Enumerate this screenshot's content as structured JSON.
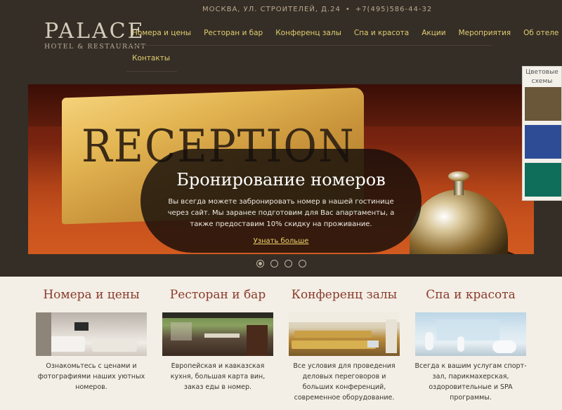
{
  "header": {
    "address": "МОСКВА, УЛ. СТРОИТЕЛЕЙ, Д.24",
    "phone": "+7(495)586-44-32"
  },
  "logo": {
    "main": "PALACE",
    "sub": "HOTEL & RESTAURANT"
  },
  "nav": {
    "items": [
      {
        "label": "Номера и цены"
      },
      {
        "label": "Ресторан и бар"
      },
      {
        "label": "Конференц залы"
      },
      {
        "label": "Спа и красота"
      },
      {
        "label": "Акции"
      },
      {
        "label": "Мероприятия"
      },
      {
        "label": "Об отеле"
      },
      {
        "label": "Контакты"
      }
    ]
  },
  "color_schemes": {
    "title": "Цветовые схемы",
    "swatches": [
      "#6a5638",
      "#2e4c96",
      "#0e6e5a"
    ]
  },
  "hero": {
    "image_text": "RECEPTION",
    "title": "Бронирование номеров",
    "text": "Вы всегда можете забронировать номер в нашей гостинице через сайт. Мы заранее подготовим для Вас апартаменты, а также предоставим 10% скидку на проживание.",
    "link": "Узнать больше",
    "slides_count": 4,
    "active_slide": 1
  },
  "features": [
    {
      "title": "Номера и цены",
      "text": "Ознакомьтесь с ценами и фотографиями наших уютных номеров."
    },
    {
      "title": "Ресторан и бар",
      "text": "Европейская и кавказская кухня, большая карта вин, заказ еды в номер."
    },
    {
      "title": "Конференц залы",
      "text": "Все условия для проведения деловых переговоров и больших конференций, современное оборудование."
    },
    {
      "title": "Спа и красота",
      "text": "Всегда к вашим услугам спорт-зал, парикмахерская, оздоровительные и SPA программы."
    }
  ]
}
